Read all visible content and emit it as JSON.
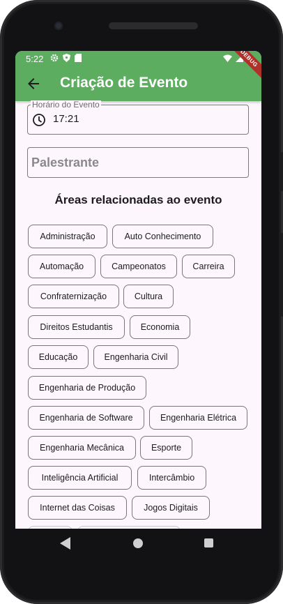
{
  "status": {
    "time": "5:22"
  },
  "appbar": {
    "title": "Criação de Evento",
    "debug_label": "DEBUG"
  },
  "form": {
    "time_label": "Horário do Evento",
    "time_value": "17:21",
    "speaker_placeholder": "Palestrante"
  },
  "areas": {
    "title": "Áreas relacionadas ao evento",
    "chips": [
      "Administração",
      "Auto Conhecimento",
      "Automação",
      "Campeonatos",
      "Carreira",
      "Confraternização",
      "Cultura",
      "Direitos Estudantis",
      "Economia",
      "Educação",
      "Engenharia Civil",
      "Engenharia de Produção",
      "Engenharia de Software",
      "Engenharia Elétrica",
      "Engenharia Mecânica",
      "Esporte",
      "Inteligência Artificial",
      "Intercâmbio",
      "Internet das Coisas",
      "Jogos Digitais"
    ]
  },
  "colors": {
    "appbar": "#5cad5f",
    "background": "#fdf7fd",
    "chip_border": "#79747e"
  },
  "icons": {
    "back": "arrow-left-icon",
    "clock": "clock-icon",
    "settings": "gear-icon",
    "shield": "shield-icon",
    "sd": "sd-card-icon",
    "wifi": "wifi-icon",
    "signal": "signal-icon",
    "battery": "battery-icon"
  }
}
